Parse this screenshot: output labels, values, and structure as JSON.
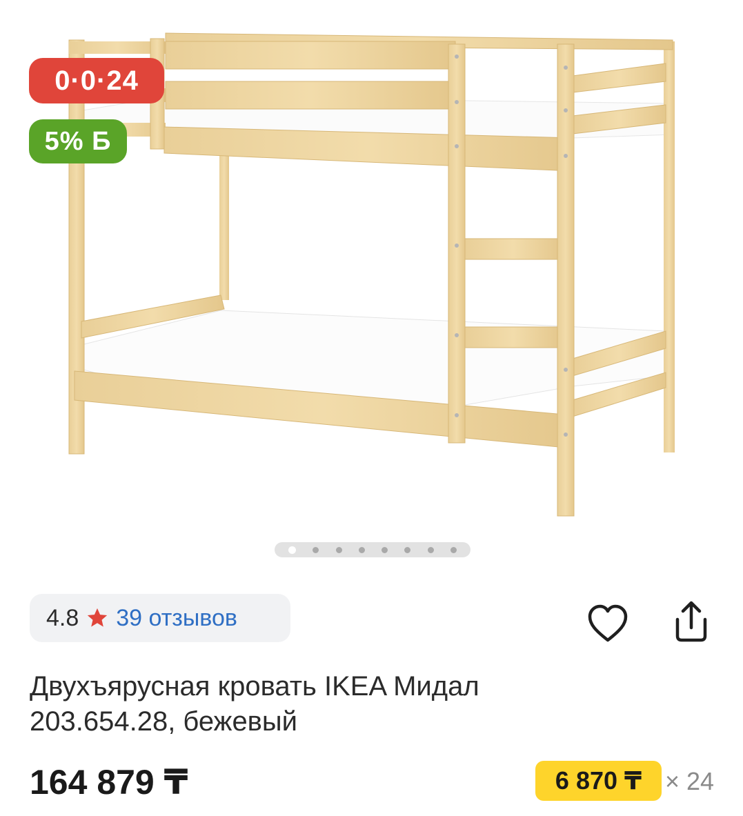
{
  "badges": {
    "installment": "0·0·24",
    "bonus": "5% Б"
  },
  "gallery": {
    "image_count": 8,
    "active_index": 0
  },
  "rating": {
    "value": "4.8",
    "reviews": "39 отзывов"
  },
  "product": {
    "title_line1": "Двухъярусная кровать IKEA Мидал",
    "title_line2": "203.654.28, бежевый",
    "price": "164 879 ₸",
    "monthly_payment": "6 870 ₸",
    "months": "× 24"
  },
  "colors": {
    "installment_badge": "#e0453a",
    "bonus_badge": "#5aa428",
    "monthly_badge": "#fed42b",
    "reviews_link": "#2f6fc4",
    "star": "#e0453a"
  },
  "icons": {
    "favorite": "heart-icon",
    "share": "share-icon",
    "rating": "star-icon"
  }
}
